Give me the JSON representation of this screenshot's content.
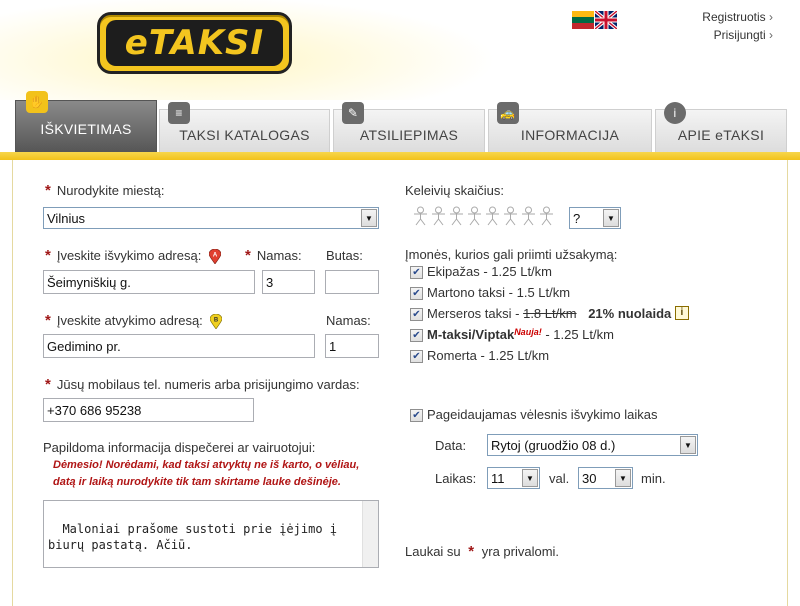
{
  "header": {
    "logo_text": "eTAKSI",
    "links": {
      "register": "Registruotis",
      "login": "Prisijungti"
    }
  },
  "tabs": [
    {
      "label": "IŠKVIETIMAS",
      "active": true
    },
    {
      "label": "TAKSI KATALOGAS",
      "active": false
    },
    {
      "label": "ATSILIEPIMAS",
      "active": false
    },
    {
      "label": "INFORMACIJA",
      "active": false
    },
    {
      "label": "APIE eTAKSI",
      "active": false
    }
  ],
  "form": {
    "city_label": "Nurodykite miestą:",
    "city_value": "Vilnius",
    "pickup_label": "Įveskite išvykimo adresą:",
    "pickup_house_label": "Namas:",
    "pickup_apt_label": "Butas:",
    "pickup_street": "Šeimyniškių g.",
    "pickup_house": "3",
    "pickup_apt": "",
    "dest_label": "Įveskite atvykimo adresą:",
    "dest_house_label": "Namas:",
    "dest_street": "Gedimino pr.",
    "dest_house": "1",
    "phone_label": "Jūsų mobilaus tel. numeris arba prisijungimo vardas:",
    "phone_value": "+370 686 95238",
    "extra_label": "Papildoma informacija dispečerei ar vairuotojui:",
    "warning": "Dėmesio! Norėdami, kad taksi atvyktų ne iš karto, o vėliau, datą ir laiką nurodykite tik tam skirtame lauke dešinėje.",
    "extra_text": "Maloniai prašome sustoti prie įėjimo į biurų pastatą. Ačiū."
  },
  "right": {
    "passengers_label": "Keleivių skaičius:",
    "passengers_value": "?",
    "companies_label": "Įmonės, kurios gali priimti užsakymą:",
    "companies": [
      {
        "name": "Ekipažas",
        "price": " - 1.25 Lt/km",
        "checked": true
      },
      {
        "name": "Martono taksi",
        "price": " - 1.5 Lt/km",
        "checked": true
      },
      {
        "name": "Merseros taksi",
        "price_old": "1.8 Lt/km",
        "discount": "21% nuolaida",
        "checked": true
      },
      {
        "name": "M-taksi/Viptak",
        "badge": "Nauja!",
        "price": " - 1.25 Lt/km",
        "checked": true
      },
      {
        "name": "Romerta",
        "price": " - 1.25 Lt/km",
        "checked": true
      }
    ],
    "later_label": "Pageidaujamas vėlesnis išvykimo laikas",
    "date_label": "Data:",
    "date_value": "Rytoj (gruodžio 08 d.)",
    "time_label": "Laikas:",
    "hour_value": "11",
    "hour_unit": "val.",
    "minute_value": "30",
    "minute_unit": "min.",
    "required_note_pre": "Laukai su",
    "required_note_post": "yra privalomi."
  }
}
